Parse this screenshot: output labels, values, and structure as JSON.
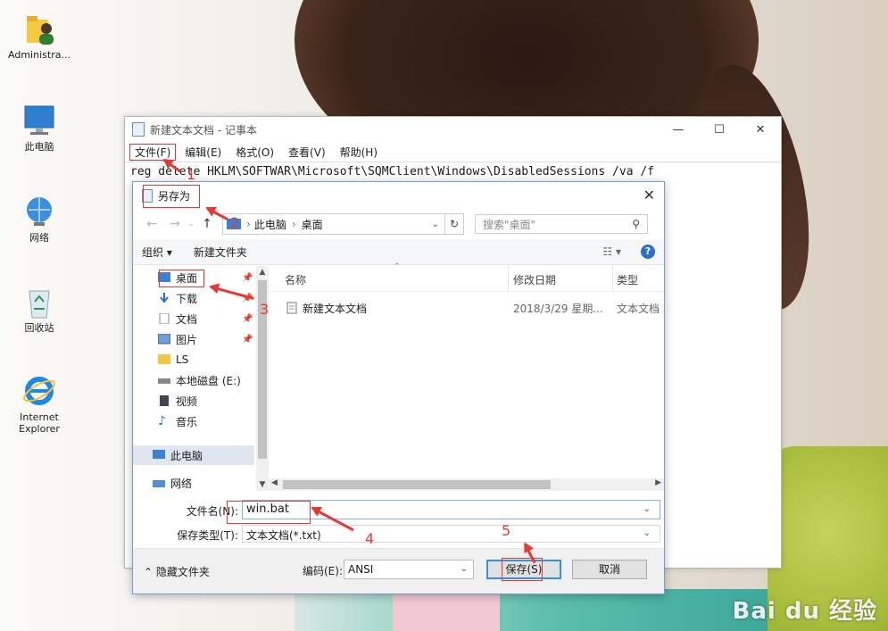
{
  "desktop": {
    "icons": [
      {
        "label": "Administra...",
        "icon": "user-folder-icon"
      },
      {
        "label": "此电脑",
        "icon": "computer-icon"
      },
      {
        "label": "网络",
        "icon": "network-icon"
      },
      {
        "label": "回收站",
        "icon": "recycle-bin-icon"
      },
      {
        "label": "Internet Explorer",
        "icon": "internet-explorer-icon"
      }
    ],
    "watermark": "Bai du 经验"
  },
  "notepad": {
    "title": "新建文本文档 - 记事本",
    "menu": [
      "文件(F)",
      "编辑(E)",
      "格式(O)",
      "查看(V)",
      "帮助(H)"
    ],
    "text": "reg delete HKLM\\SOFTWAR\\Microsoft\\SQMClient\\Windows\\DisabledSessions /va /f",
    "controls": {
      "minimize": "—",
      "maximize": "☐",
      "close": "✕"
    }
  },
  "dialog": {
    "title": "另存为",
    "close": "✕",
    "address": {
      "root": "此电脑",
      "current": "桌面"
    },
    "search_placeholder": "搜索\"桌面\"",
    "toolbar": {
      "organize": "组织 ▾",
      "new_folder": "新建文件夹"
    },
    "nav_items": [
      {
        "label": "桌面",
        "pinned": true,
        "selected": true
      },
      {
        "label": "下载",
        "pinned": true
      },
      {
        "label": "文档",
        "pinned": true
      },
      {
        "label": "图片",
        "pinned": true
      },
      {
        "label": "LS"
      },
      {
        "label": "本地磁盘 (E:)"
      },
      {
        "label": "视频"
      },
      {
        "label": "音乐"
      },
      {
        "label": "此电脑",
        "highlight": true
      },
      {
        "label": "网络"
      }
    ],
    "columns": [
      "名称",
      "修改日期",
      "类型"
    ],
    "files": [
      {
        "name": "新建文本文档",
        "date": "2018/3/29 星期...",
        "type": "文本文档"
      }
    ],
    "filename_label": "文件名(N):",
    "filename_value": "win.bat",
    "filetype_label": "保存类型(T):",
    "filetype_value": "文本文档(*.txt)",
    "hide_folders": "隐藏文件夹",
    "encoding_label": "编码(E):",
    "encoding_value": "ANSI",
    "save": "保存(S)",
    "cancel": "取消"
  },
  "annotations": [
    "1",
    "2",
    "3",
    "4",
    "5"
  ],
  "colors": {
    "annotation": "#e53935",
    "accent": "#3b8ee0"
  }
}
